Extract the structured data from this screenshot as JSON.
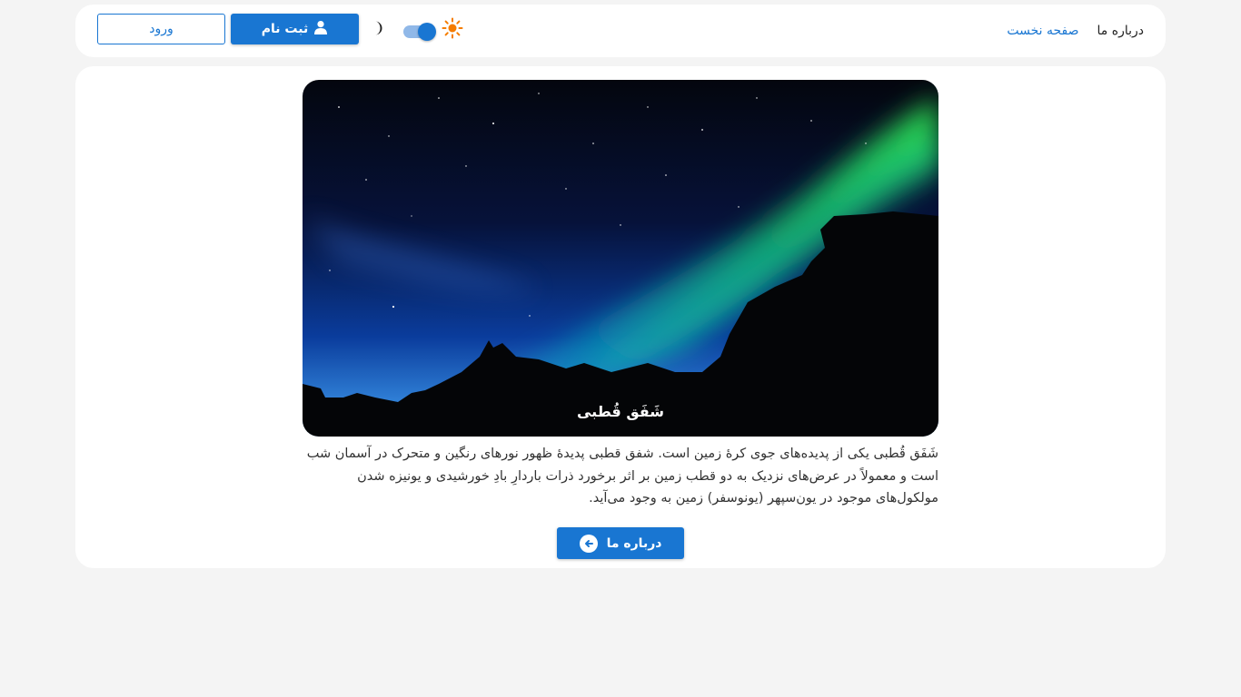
{
  "nav": {
    "links": [
      {
        "label": "صفحه نخست",
        "active": true
      },
      {
        "label": "درباره ما",
        "active": false
      }
    ],
    "theme_toggle": {
      "light_icon": "sun-icon",
      "dark_icon": "moon-icon",
      "checked": true
    },
    "register_label": "ثبت نام",
    "register_icon": "user-icon",
    "login_label": "ورود"
  },
  "hero": {
    "caption": "شَفَق قُطبی",
    "image": "aurora-night-sky-over-mountains"
  },
  "description": "شَفَق قُطبی یکی از پدیده‌های جوی کرهٔ زمین است. شفق قطبی پدیدهٔ ظهور نورهای رنگین و متحرک در آسمان شب است و معمولاً در عرض‌های نزدیک به دو قطب زمین بر اثر برخورد ذرات باردارِ بادِ خورشیدی و یونیزه شدن مولکول‌های موجود در یون‌سپهر (یونوسفر) زمین به وجود می‌آید.",
  "about_button": {
    "label": "درباره ما",
    "icon": "arrow-left-circle-icon"
  },
  "colors": {
    "primary": "#1976d2",
    "background": "#f4f4f4",
    "card": "#ffffff",
    "sun": "#f57c00"
  }
}
